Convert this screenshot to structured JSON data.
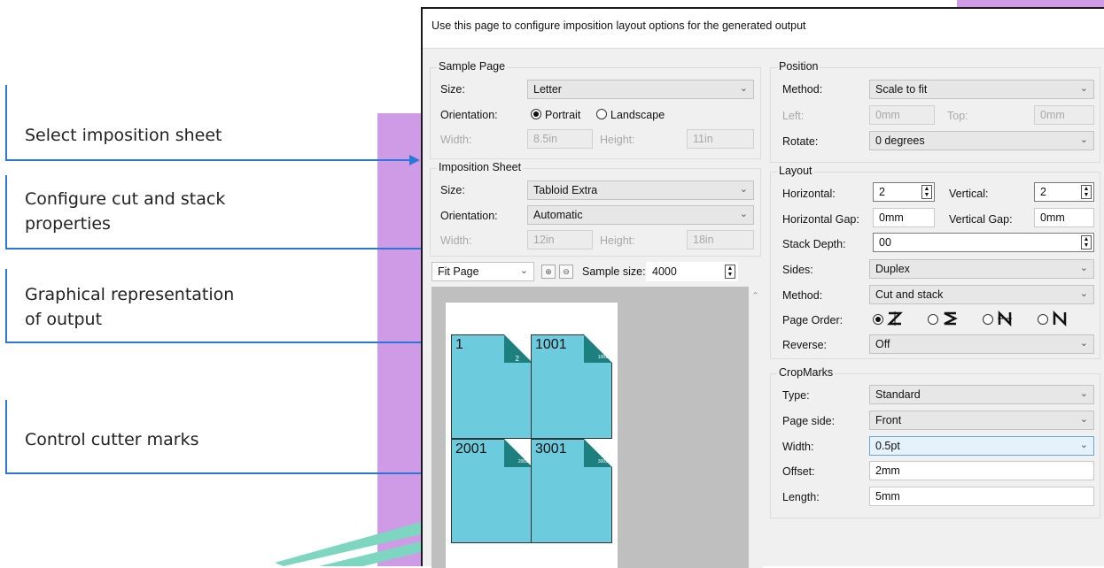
{
  "callouts": {
    "c1": "Select imposition sheet",
    "c2a": "Configure cut and stack",
    "c2b": "properties",
    "c3a": "Graphical representation",
    "c3b": "of output",
    "c4": "Control cutter marks"
  },
  "header": "Use this page to configure imposition layout options for the generated output",
  "sample_page": {
    "title": "Sample Page",
    "size_label": "Size:",
    "size_value": "Letter",
    "orientation_label": "Orientation:",
    "portrait": "Portrait",
    "landscape": "Landscape",
    "width_label": "Width:",
    "width_value": "8.5in",
    "height_label": "Height:",
    "height_value": "11in"
  },
  "imposition_sheet": {
    "title": "Imposition Sheet",
    "size_label": "Size:",
    "size_value": "Tabloid Extra",
    "orientation_label": "Orientation:",
    "orientation_value": "Automatic",
    "width_label": "Width:",
    "width_value": "12in",
    "height_label": "Height:",
    "height_value": "18in"
  },
  "preview_bar": {
    "fit_value": "Fit Page",
    "sample_size_label": "Sample size:",
    "sample_size_value": "4000"
  },
  "tiles": [
    {
      "num": "1",
      "corner": "2"
    },
    {
      "num": "1001",
      "corner": "1002"
    },
    {
      "num": "2001",
      "corner": "2002"
    },
    {
      "num": "3001",
      "corner": "3002"
    }
  ],
  "position": {
    "title": "Position",
    "method_label": "Method:",
    "method_value": "Scale to fit",
    "left_label": "Left:",
    "left_value": "0mm",
    "top_label": "Top:",
    "top_value": "0mm",
    "rotate_label": "Rotate:",
    "rotate_value": "0 degrees"
  },
  "layout": {
    "title": "Layout",
    "horizontal_label": "Horizontal:",
    "horizontal_value": "2",
    "vertical_label": "Vertical:",
    "vertical_value": "2",
    "hgap_label": "Horizontal Gap:",
    "hgap_value": "0mm",
    "vgap_label": "Vertical Gap:",
    "vgap_value": "0mm",
    "stack_label": "Stack Depth:",
    "stack_value": "00",
    "sides_label": "Sides:",
    "sides_value": "Duplex",
    "method_label": "Method:",
    "method_value": "Cut and stack",
    "order_label": "Page Order:",
    "reverse_label": "Reverse:",
    "reverse_value": "Off"
  },
  "cropmarks": {
    "title": "CropMarks",
    "type_label": "Type:",
    "type_value": "Standard",
    "side_label": "Page side:",
    "side_value": "Front",
    "width_label": "Width:",
    "width_value": "0.5pt",
    "offset_label": "Offset:",
    "offset_value": "2mm",
    "length_label": "Length:",
    "length_value": "5mm"
  },
  "colors": {
    "accent_line": "#2b77d8",
    "deco": "#cf9be6",
    "tile": "#6ccbdc",
    "corner": "#1e7f7f"
  }
}
